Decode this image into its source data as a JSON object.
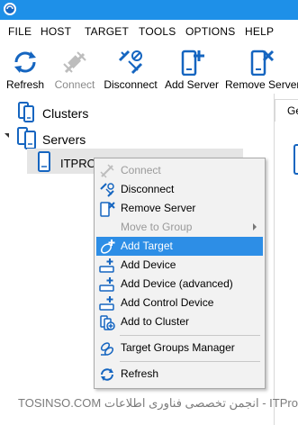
{
  "menu": [
    "FILE",
    "HOST",
    "TARGET",
    "TOOLS",
    "OPTIONS",
    "HELP"
  ],
  "toolbar": {
    "refresh": "Refresh",
    "connect": "Connect",
    "disconnect": "Disconnect",
    "add_server": "Add Server",
    "remove_server": "Remove Server"
  },
  "tree": {
    "clusters": "Clusters",
    "servers": "Servers",
    "server_item": "ITPRO"
  },
  "tab_label": "Ge",
  "context_menu": {
    "connect": "Connect",
    "disconnect": "Disconnect",
    "remove_server": "Remove Server",
    "move_to_group": "Move to Group",
    "add_target": "Add Target",
    "add_device": "Add Device",
    "add_device_advanced": "Add Device (advanced)",
    "add_control_device": "Add Control Device",
    "add_to_cluster": "Add to Cluster",
    "target_groups_manager": "Target Groups Manager",
    "refresh": "Refresh"
  },
  "watermark": "TOSINSO.COM انجمن تخصصی فناوری اطلاعات - ITPro.ir",
  "colors": {
    "titlebar": "#1e90e8",
    "accent": "#1565c0",
    "highlight": "#2d8ee6"
  }
}
